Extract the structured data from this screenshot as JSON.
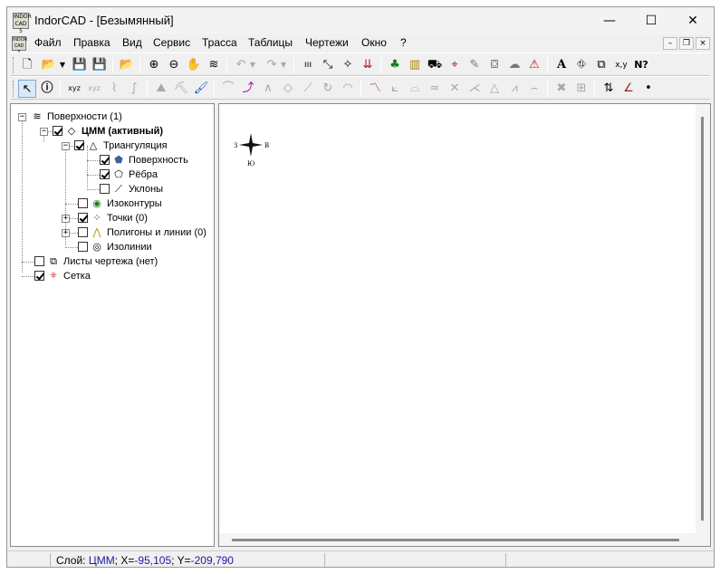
{
  "window": {
    "title": "IndorCAD - [Безымянный]",
    "app_icon_text": "INDOR CAD 5",
    "controls": {
      "minimize": "—",
      "maximize": "☐",
      "close": "✕"
    },
    "mdi_controls": {
      "minimize": "–",
      "restore": "❐",
      "close": "×"
    }
  },
  "menu": {
    "items": [
      "Файл",
      "Правка",
      "Вид",
      "Сервис",
      "Трасса",
      "Таблицы",
      "Чертежи",
      "Окно",
      "?"
    ]
  },
  "toolbar1": {
    "icons": [
      "new-file-icon",
      "open-folder-icon",
      "dropdown-arrow-icon",
      "save-icon",
      "save-all-icon",
      "open-project-icon",
      "zoom-in-icon",
      "zoom-out-icon",
      "pan-hand-icon",
      "layers-icon",
      "undo-icon",
      "undo-dropdown-icon",
      "redo-icon",
      "redo-dropdown-icon",
      "ruler-icon",
      "measure-line-icon",
      "snap-icon",
      "import-icon",
      "tree-icon",
      "building-icon",
      "car-icon",
      "survey-point-icon",
      "edit-point-icon",
      "camera-icon",
      "cloud-icon",
      "warning-icon",
      "text-icon",
      "road-sign-icon",
      "copy-sheet-icon",
      "coordinate-icon",
      "help-cursor-icon"
    ]
  },
  "toolbar2": {
    "icons": [
      "select-arrow-icon",
      "info-icon",
      "xyz-point-icon",
      "xyz-points-icon",
      "xyz-polyline-icon",
      "xyz-curve-icon",
      "surface-build-icon",
      "surface-edit-icon",
      "brush-icon",
      "breakline-icon",
      "breakline-add-icon",
      "lines-icon",
      "constraint-icon",
      "line-edit-icon",
      "rotate-icon",
      "arc-icon",
      "profile-icon",
      "slope-icon",
      "terrain-icon",
      "wave-icon",
      "cross-icon",
      "split-icon",
      "triangle-icon",
      "zigzag-icon",
      "bridge-icon",
      "delete-point-icon",
      "fence-icon",
      "flip-icon",
      "angle-icon",
      "dot-icon"
    ]
  },
  "tree": {
    "root": "Поверхности (1)",
    "dtm": "ЦММ (активный)",
    "triangulation": "Триангуляция",
    "surface": "Поверхность",
    "edges": "Рёбра",
    "slopes": "Уклоны",
    "isocontours": "Изоконтуры",
    "points": "Точки (0)",
    "polygons": "Полигоны и линии (0)",
    "isolines": "Изолинии",
    "sheets": "Листы чертежа (нет)",
    "grid": "Сетка"
  },
  "compass": {
    "west": "З",
    "east": "В",
    "south": "Ю"
  },
  "status": {
    "layer_label": "Слой:",
    "layer_value": "ЦММ",
    "x_label": "; X=",
    "x_value": "-95,105",
    "y_label": "; Y=",
    "y_value": "-209,790"
  }
}
